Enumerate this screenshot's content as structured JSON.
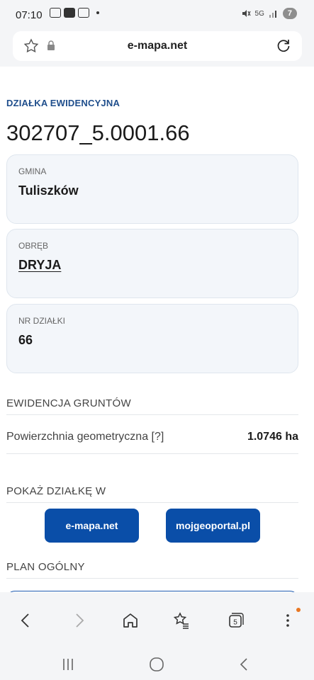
{
  "status_bar": {
    "time": "07:10",
    "network": "5G",
    "battery": "7"
  },
  "url_bar": {
    "url": "e-mapa.net"
  },
  "parcel": {
    "section_label": "DZIAŁKA EWIDENCYJNA",
    "id": "302707_5.0001.66",
    "cards": [
      {
        "label": "GMINA",
        "value": "Tuliszków"
      },
      {
        "label": "OBRĘB",
        "value": "DRYJA"
      },
      {
        "label": "NR DZIAŁKI",
        "value": "66"
      }
    ]
  },
  "ewidencja": {
    "heading": "EWIDENCJA GRUNTÓW",
    "row_label": "Powierzchnia geometryczna [?]",
    "row_value": "1.0746 ha"
  },
  "pokaz": {
    "heading": "POKAŻ DZIAŁKĘ W",
    "buttons": [
      "e-mapa.net",
      "mojgeoportal.pl"
    ]
  },
  "plan": {
    "heading": "PLAN OGÓLNY"
  },
  "toolbar": {
    "tabs_count": "5"
  },
  "colors": {
    "accent": "#0a4ea8",
    "section_label": "#1f4e8c",
    "card_bg": "#f3f6fa",
    "notification_dot": "#e87722"
  }
}
